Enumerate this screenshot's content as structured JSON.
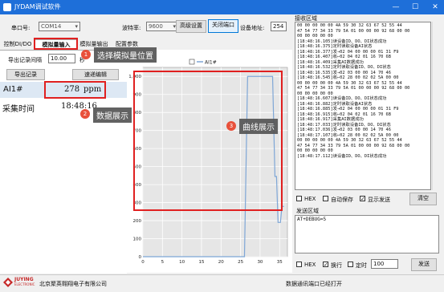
{
  "window": {
    "title": "JYDAM调试软件",
    "minimize": "—",
    "maximize": "☐",
    "close": "✕"
  },
  "toolbar": {
    "port_label": "串口号:",
    "port_value": "COM14",
    "baud_label": "波特率:",
    "baud_value": "9600",
    "advanced_btn": "高级设置",
    "close_port_btn": "关闭端口",
    "device_addr_label": "设备地址:",
    "device_addr_value": "254"
  },
  "tabs": [
    "控制DI/DO",
    "模拟量输入",
    "模拟量输出",
    "配置参数"
  ],
  "controls": {
    "export_interval_label": "导出记录间隔",
    "export_interval_value": "10.00",
    "export_interval_unit": "秒",
    "export_btn": "导出记录",
    "clear_curve_btn": "速递编辑"
  },
  "reading": {
    "channel": "AI1#",
    "value": "278",
    "unit": "ppm",
    "time_label": "采集时间",
    "time_value": "18:48:16"
  },
  "callouts": [
    {
      "num": "1",
      "text": "选择模拟量位置"
    },
    {
      "num": "2",
      "text": "数据展示"
    },
    {
      "num": "3",
      "text": "曲线展示"
    }
  ],
  "receive": {
    "title": "接收区域",
    "log": "00 00 00 00 00 4A 59 30 32 63 67 52 55 44\n47 54 77 34 33 79 5A 01 00 00 00 92 68 00 00\n00 00 00 00 00\n[18:48:16.105]读设备ID、DO、DI状态成功\n[18:48:16.375]定时读取设备AI状态\n[18:48:16.377]发→02 04 00 00 00 01 31 F9\n[18:48:16.407]收←02 04 02 01 16 70 6B\n[18:48:16.409]采集AI数据成功\n[18:48:16.532]定时读取设备ID、DO、DI状态\n[18:48:16.535]发→02 03 00 00 14 70 46\n[18:48:16.545]收←02 28 00 02 02 5A 00 00\n00 00 00 00 00 4A 59 30 32 63 67 52 55 44\n47 54 77 34 33 79 5A 01 00 00 00 92 68 00 00\n00 00 00 00 00\n[18:48:16.607]读设备ID、DO、DI状态成功\n[18:48:16.882]定时读取设备AI状态\n[18:48:16.885]发→02 04 00 00 00 01 31 F9\n[18:48:16.915]收←02 04 02 01 16 70 6B\n[18:48:16.917]采集AI数据成功\n[18:48:17.033]定时读取设备ID、DO、DI状态\n[18:48:17.036]发→02 03 00 00 14 70 46\n[18:48:17.107]收←02 28 00 02 02 5A 00 00\n00 00 00 00 00 4A 59 30 32 63 67 52 55 44\n47 54 77 34 33 79 5A 01 00 00 00 92 68 00 00\n00 00 00 00 00\n[18:48:17.112]读设备ID、DO、DI状态成功",
    "hex_label": "HEX",
    "autosave_label": "自动保存",
    "show_send_label": "显示发送",
    "clear_btn": "清空"
  },
  "send": {
    "title": "发送区域",
    "content": "AT+DEBUG=5",
    "hex_label": "HEX",
    "newline_label": "换行",
    "timer_label": "定时",
    "timer_value": "100",
    "send_btn": "发送"
  },
  "status": {
    "company": "北京聚英翱翔电子有限公司",
    "logo_text": "JUYING",
    "logo_sub": "ELECTRONIC",
    "message": "数据通讯端口已经打开"
  },
  "chart_data": {
    "type": "line",
    "series": [
      {
        "name": "AI1#",
        "color": "#7ea6d6",
        "x": [
          0,
          26,
          26.8,
          27.2,
          33.2,
          33.8,
          34.2,
          34.6,
          35.2,
          35.6,
          36.1
        ],
        "y": [
          0,
          0,
          1000,
          1000,
          1000,
          445,
          445,
          190,
          190,
          280,
          278
        ]
      }
    ],
    "xlim": [
      0,
      37
    ],
    "ylim": [
      0,
      1050
    ],
    "xticks": [
      0,
      5,
      10,
      15,
      20,
      25,
      30,
      35
    ],
    "yticks": [
      0,
      100,
      200,
      300,
      400,
      500,
      600,
      700,
      800,
      900,
      1000
    ],
    "ytick_labels": [
      "0",
      "100",
      "200",
      "300",
      "400",
      "500",
      "600",
      "700",
      "800",
      "900",
      "1,000"
    ],
    "grid": true,
    "legend": "top-center"
  }
}
